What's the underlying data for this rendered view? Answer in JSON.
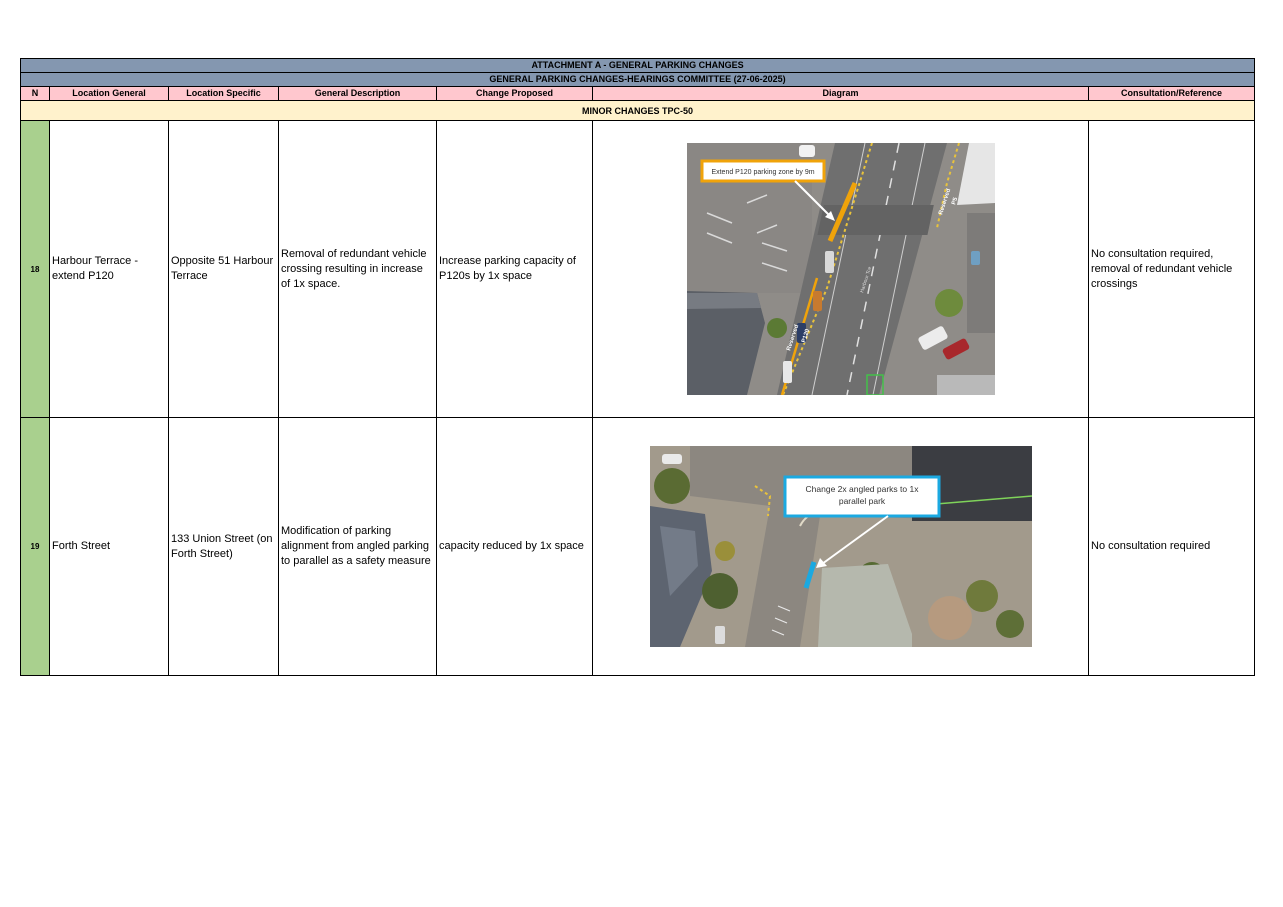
{
  "title": "ATTACHMENT A - GENERAL PARKING CHANGES",
  "subtitle": "GENERAL PARKING CHANGES-HEARINGS COMMITTEE (27-06-2025)",
  "columns": [
    "N",
    "Location General",
    "Location Specific",
    "General Description",
    "Change Proposed",
    "Diagram",
    "Consultation/Reference"
  ],
  "section": "MINOR CHANGES TPC-50",
  "rows": [
    {
      "n": "18",
      "location_general": "Harbour Terrace - extend P120",
      "location_specific": "Opposite 51 Harbour Terrace",
      "description": "Removal of redundant vehicle crossing resulting in increase of 1x space.",
      "change": "Increase parking capacity of P120s by 1x space",
      "consultation": "No consultation required, removal of redundant vehicle crossings",
      "diagram": {
        "callout": "Extend P120 parking zone by 9m",
        "street_label": "Harbour Tce",
        "road_markings": [
          "Reserved",
          "P120",
          "Reserved",
          "P5"
        ],
        "accent": "#f5a623"
      }
    },
    {
      "n": "19",
      "location_general": "Forth Street",
      "location_specific": "133 Union Street (on Forth Street)",
      "description": "Modification of parking alignment from angled parking to parallel as a safety measure",
      "change": "capacity reduced by 1x space",
      "consultation": "No consultation required",
      "diagram": {
        "callout_line1": "Change 2x angled parks to 1x",
        "callout_line2": "parallel park",
        "accent": "#1ba9e1"
      }
    }
  ]
}
